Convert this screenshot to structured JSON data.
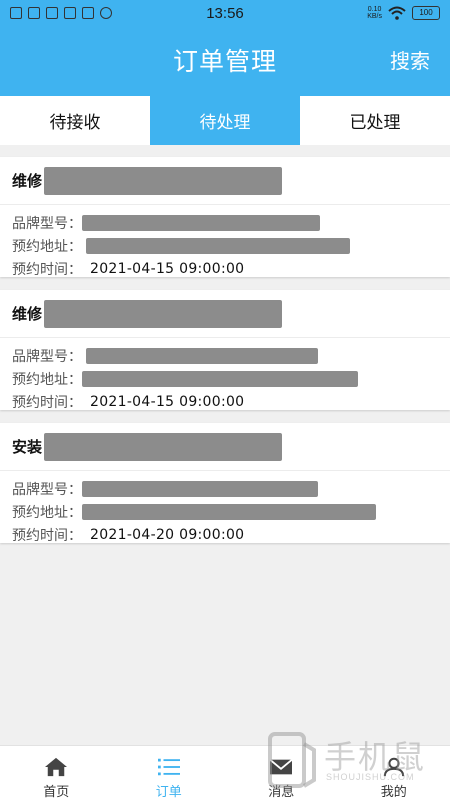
{
  "status_bar": {
    "time": "13:56",
    "net_speed_value": "0.10",
    "net_speed_unit": "KB/s",
    "battery": "100"
  },
  "header": {
    "title": "订单管理",
    "search_label": "搜索"
  },
  "tabs": [
    {
      "label": "待接收",
      "active": false
    },
    {
      "label": "待处理",
      "active": true
    },
    {
      "label": "已处理",
      "active": false
    }
  ],
  "orders": [
    {
      "type": "维修",
      "brand_label": "品牌型号：",
      "address_label": "预约地址：",
      "time_label": "预约时间：",
      "time_value": "2021-04-15 09:00:00"
    },
    {
      "type": "维修",
      "brand_label": "品牌型号：",
      "address_label": "预约地址：",
      "time_label": "预约时间：",
      "time_value": "2021-04-15 09:00:00"
    },
    {
      "type": "安装",
      "brand_label": "品牌型号：",
      "address_label": "预约地址：",
      "time_label": "预约时间：",
      "time_value": "2021-04-20 09:00:00"
    }
  ],
  "bottom_nav": [
    {
      "label": "首页",
      "icon": "home-icon",
      "active": false
    },
    {
      "label": "订单",
      "icon": "list-icon",
      "active": true
    },
    {
      "label": "消息",
      "icon": "mail-icon",
      "active": false
    },
    {
      "label": "我的",
      "icon": "user-icon",
      "active": false
    }
  ],
  "watermark": {
    "text": "手机鼠",
    "sub": "SHOUJISHU.COM"
  },
  "colors": {
    "accent": "#3fb3f0",
    "redaction": "#8c8c8c"
  }
}
